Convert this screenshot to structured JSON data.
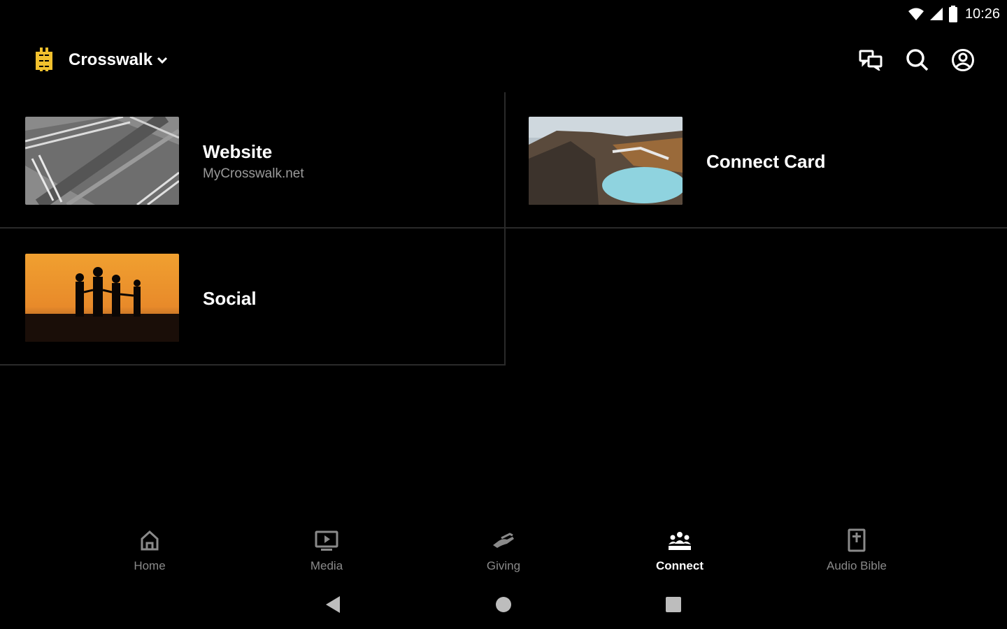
{
  "status_bar": {
    "time": "10:26",
    "icons": [
      "wifi-icon",
      "cell-signal-icon",
      "battery-icon"
    ]
  },
  "app_bar": {
    "church_name": "Crosswalk",
    "icons": [
      "logo-icon",
      "chevron-down-icon",
      "chat-icon",
      "search-icon",
      "account-icon"
    ]
  },
  "cards": [
    {
      "title": "Website",
      "subtitle": "MyCrosswalk.net"
    },
    {
      "title": "Connect Card",
      "subtitle": ""
    },
    {
      "title": "Social",
      "subtitle": ""
    }
  ],
  "bottom_nav": [
    {
      "label": "Home",
      "icon": "home-icon"
    },
    {
      "label": "Media",
      "icon": "tv-play-icon"
    },
    {
      "label": "Giving",
      "icon": "giving-hand-icon"
    },
    {
      "label": "Connect",
      "icon": "group-icon",
      "active": true
    },
    {
      "label": "Audio Bible",
      "icon": "bible-icon"
    }
  ],
  "system_nav": [
    "back-icon",
    "home-circle-icon",
    "recents-square-icon"
  ],
  "colors": {
    "background": "#000000",
    "text": "#ffffff",
    "muted": "#8a8a8a",
    "logo": "#f2c12e"
  }
}
